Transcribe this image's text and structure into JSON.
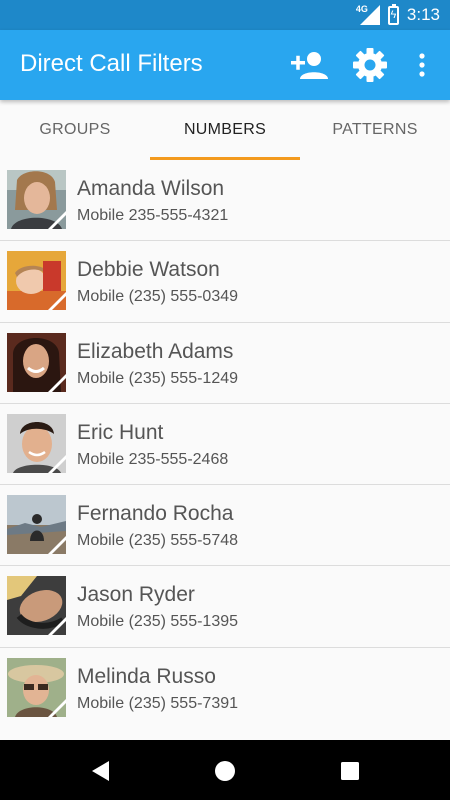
{
  "status_bar": {
    "network": "4G",
    "time": "3:13"
  },
  "app_bar": {
    "title": "Direct Call Filters",
    "actions": [
      "add-contact-icon",
      "settings-gear-icon",
      "overflow-menu-icon"
    ],
    "color": "#29a6ef",
    "status_color": "#1e88c9"
  },
  "tabs": [
    {
      "label": "GROUPS",
      "active": false
    },
    {
      "label": "NUMBERS",
      "active": true
    },
    {
      "label": "PATTERNS",
      "active": false
    }
  ],
  "accent_color": "#f39a1e",
  "contacts": [
    {
      "name": "Amanda Wilson",
      "type": "Mobile",
      "number": "235-555-4321"
    },
    {
      "name": "Debbie Watson",
      "type": "Mobile",
      "number": "(235) 555-0349"
    },
    {
      "name": "Elizabeth Adams",
      "type": "Mobile",
      "number": "(235) 555-1249"
    },
    {
      "name": "Eric Hunt",
      "type": "Mobile",
      "number": "235-555-2468"
    },
    {
      "name": "Fernando Rocha",
      "type": "Mobile",
      "number": "(235) 555-5748"
    },
    {
      "name": "Jason Ryder",
      "type": "Mobile",
      "number": "(235) 555-1395"
    },
    {
      "name": "Melinda Russo",
      "type": "Mobile",
      "number": "(235) 555-7391"
    }
  ],
  "nav_bar": [
    "back-icon",
    "home-icon",
    "recents-icon"
  ]
}
